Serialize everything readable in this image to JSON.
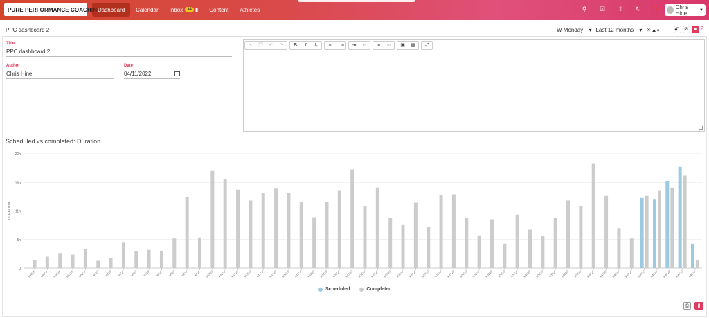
{
  "brand": {
    "name": "PURE PERFORMANCE COACHING",
    "accent": "#e03a5c",
    "header_gradient": [
      "#d4452d",
      "#e0507a"
    ]
  },
  "nav": {
    "items": [
      {
        "label": "Dashboard",
        "active": true
      },
      {
        "label": "Calendar"
      },
      {
        "label": "Inbox",
        "badge": "34"
      },
      {
        "label": "Content"
      },
      {
        "label": "Athletes"
      }
    ]
  },
  "top_icons": [
    "search-icon",
    "check-square-icon",
    "upload-icon",
    "sync-icon",
    "help-icon"
  ],
  "user": {
    "name": "Chris Hine"
  },
  "subbar": {
    "title": "PPC dashboard 2",
    "week_start": "W Monday",
    "range": "Last 12 months",
    "sports_more": "··"
  },
  "form": {
    "title_label": "Title",
    "title_value": "PPC dashboard 2",
    "author_label": "Author",
    "author_value": "Chris Hine",
    "date_label": "Date",
    "date_value": "04/11/2022"
  },
  "editor_toolbar": [
    [
      "cut-icon",
      "copy-icon",
      "undo-icon",
      "redo-icon"
    ],
    [
      "bold-icon",
      "italic-icon",
      "clear-format-icon"
    ],
    [
      "numbered-list-icon",
      "bullet-list-icon"
    ],
    [
      "indent-icon",
      "outdent-icon"
    ],
    [
      "link-icon",
      "unlink-icon"
    ],
    [
      "image-icon",
      "table-icon"
    ],
    [
      "fullscreen-icon"
    ]
  ],
  "chart_data": {
    "type": "bar",
    "title": "Scheduled vs completed: Duration",
    "ylabel": "DURATION",
    "xlabel": "",
    "ylim": [
      0,
      22
    ],
    "yticks": [
      {
        "value": 0,
        "label": "0"
      },
      {
        "value": 5.5,
        "label": "5h"
      },
      {
        "value": 11,
        "label": "11h"
      },
      {
        "value": 16.5,
        "label": "16h"
      },
      {
        "value": 22,
        "label": "22h"
      }
    ],
    "categories": [
      "w48'21",
      "w49'21",
      "w50'21",
      "w51'21",
      "w52'21",
      "w1'22",
      "w2'22",
      "w3'22",
      "w4'22",
      "w5'22",
      "w6'22",
      "w7'22",
      "w8'22",
      "w9'22",
      "w10'22",
      "w11'22",
      "w12'22",
      "w13'22",
      "w14'22",
      "w15'22",
      "w16'22",
      "w17'22",
      "w18'22",
      "w19'22",
      "w20'22",
      "w21'22",
      "w22'22",
      "w23'22",
      "w24'22",
      "w25'22",
      "w26'22",
      "w27'22",
      "w28'22",
      "w29'22",
      "w30'22",
      "w31'22",
      "w32'22",
      "w33'22",
      "w34'22",
      "w35'22",
      "w36'22",
      "w37'22",
      "w38'22",
      "w39'22",
      "w40'22",
      "w41'22",
      "w42'22",
      "w43'22",
      "w44'22",
      "w45'22",
      "w46'22",
      "w47'22",
      "w48'22"
    ],
    "series": [
      {
        "name": "Scheduled",
        "color": "#9ecae1",
        "values": [
          0,
          0,
          0,
          0,
          0,
          0,
          0,
          0,
          0,
          0,
          0,
          0,
          0,
          0,
          0,
          0,
          0,
          0,
          0,
          0,
          0,
          0,
          0,
          0,
          0,
          0,
          0,
          0,
          0,
          0,
          0,
          0,
          0,
          0,
          0,
          0,
          0,
          0,
          0,
          0,
          0,
          0,
          0,
          0,
          0,
          0,
          0,
          0,
          13.5,
          13.3,
          16.8,
          19.5,
          4.7
        ]
      },
      {
        "name": "Completed",
        "color": "#cccccc",
        "values": [
          1.6,
          2.2,
          2.9,
          2.6,
          3.7,
          1.4,
          1.9,
          4.9,
          3.2,
          3.5,
          3.3,
          5.7,
          13.6,
          5.9,
          18.7,
          17.2,
          15.1,
          13.0,
          14.5,
          15.3,
          14.4,
          12.7,
          9.8,
          12.8,
          15.0,
          19.0,
          12.0,
          15.5,
          9.7,
          8.3,
          12.6,
          8.0,
          14.0,
          14.2,
          9.7,
          6.3,
          9.4,
          4.7,
          10.3,
          7.4,
          6.2,
          9.7,
          13.0,
          12.0,
          20.2,
          13.9,
          7.7,
          5.7,
          13.9,
          15.0,
          15.5,
          17.8,
          1.5
        ]
      }
    ],
    "legend": "bottom-center",
    "grid": true
  },
  "bottom_icons": [
    "print-icon",
    "chat-icon"
  ]
}
